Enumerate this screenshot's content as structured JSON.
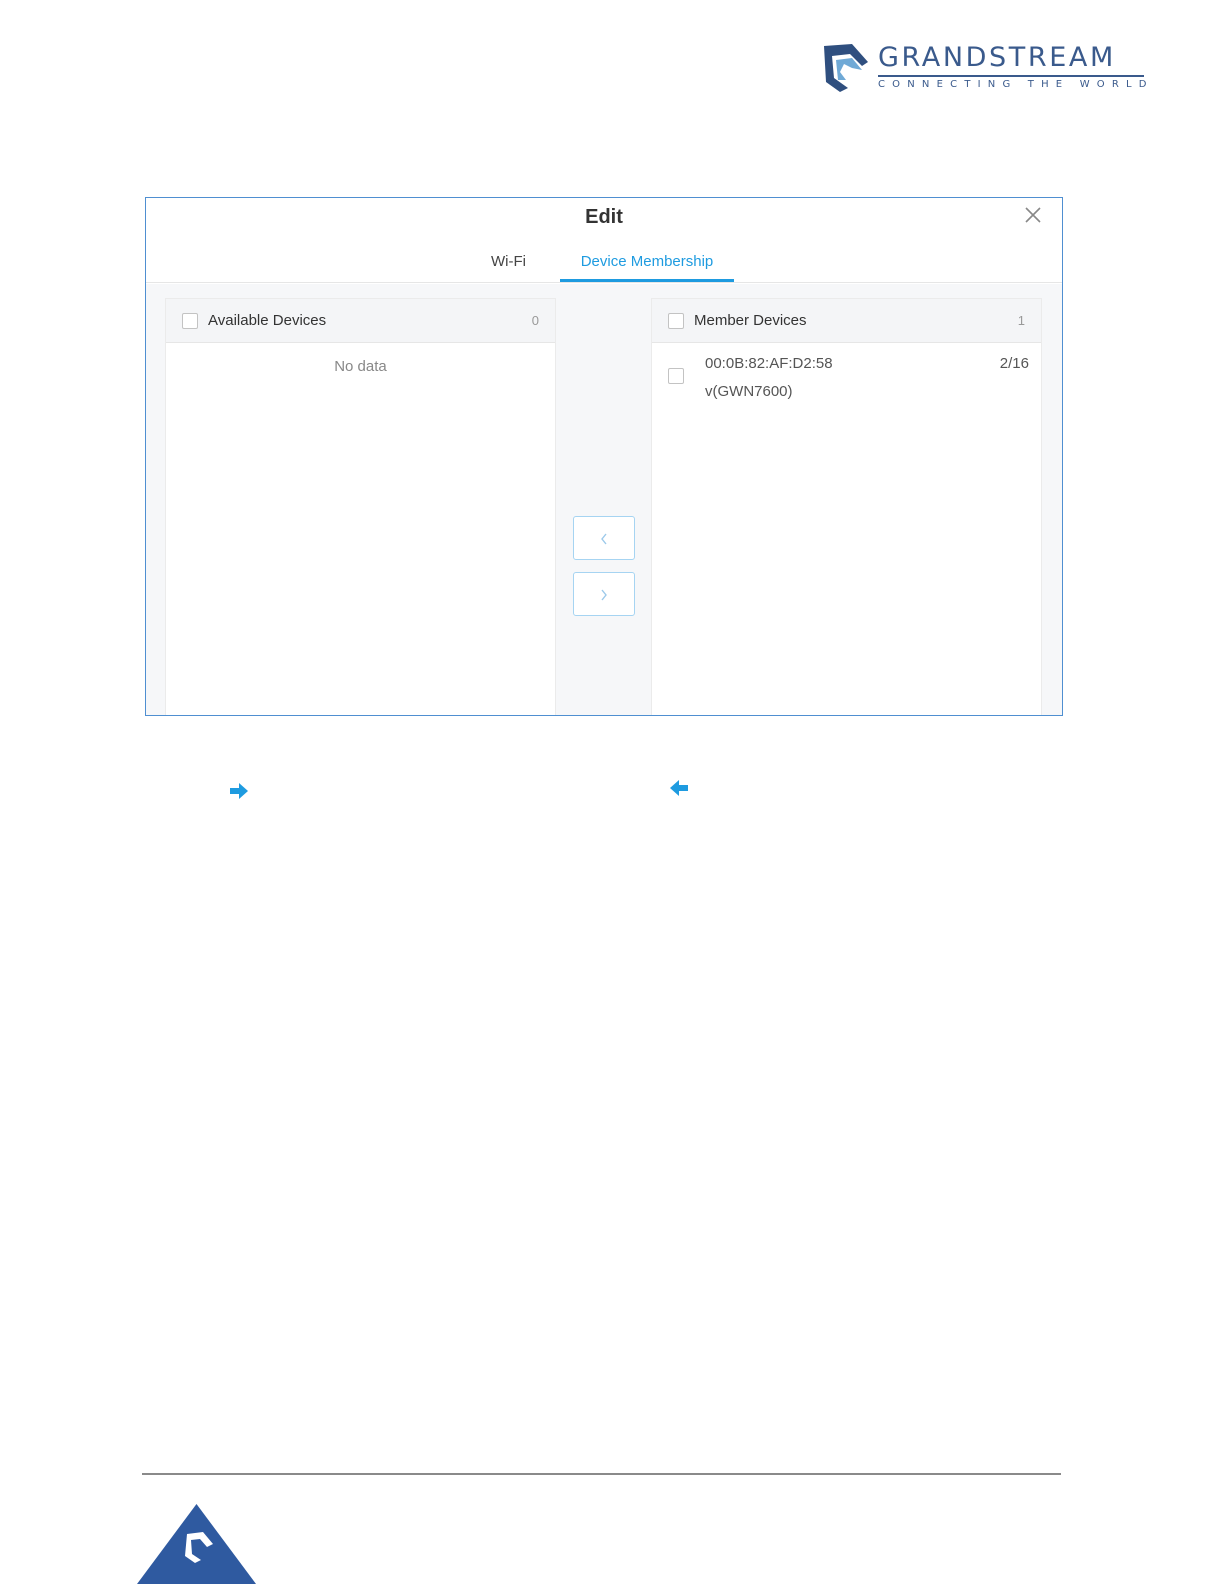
{
  "brand": {
    "name": "GRANDSTREAM",
    "tagline": "CONNECTING THE WORLD",
    "color": "#3a5a8c"
  },
  "modal": {
    "title": "Edit",
    "close_icon": "close-icon",
    "tabs": [
      {
        "label": "Wi-Fi",
        "active": false
      },
      {
        "label": "Device Membership",
        "active": true
      }
    ],
    "accent_color": "#1e9be0"
  },
  "available_panel": {
    "title": "Available Devices",
    "count": "0",
    "empty_text": "No data"
  },
  "member_panel": {
    "title": "Member Devices",
    "count": "1",
    "devices": [
      {
        "mac": "00:0B:82:AF:D2:58",
        "model": "v(GWN7600)",
        "slot": "2/16"
      }
    ]
  },
  "transfer": {
    "move_left_icon": "chevron-left-icon",
    "move_right_icon": "chevron-right-icon"
  },
  "inline_icons": {
    "right": "arrow-right-icon",
    "left": "arrow-left-icon"
  }
}
